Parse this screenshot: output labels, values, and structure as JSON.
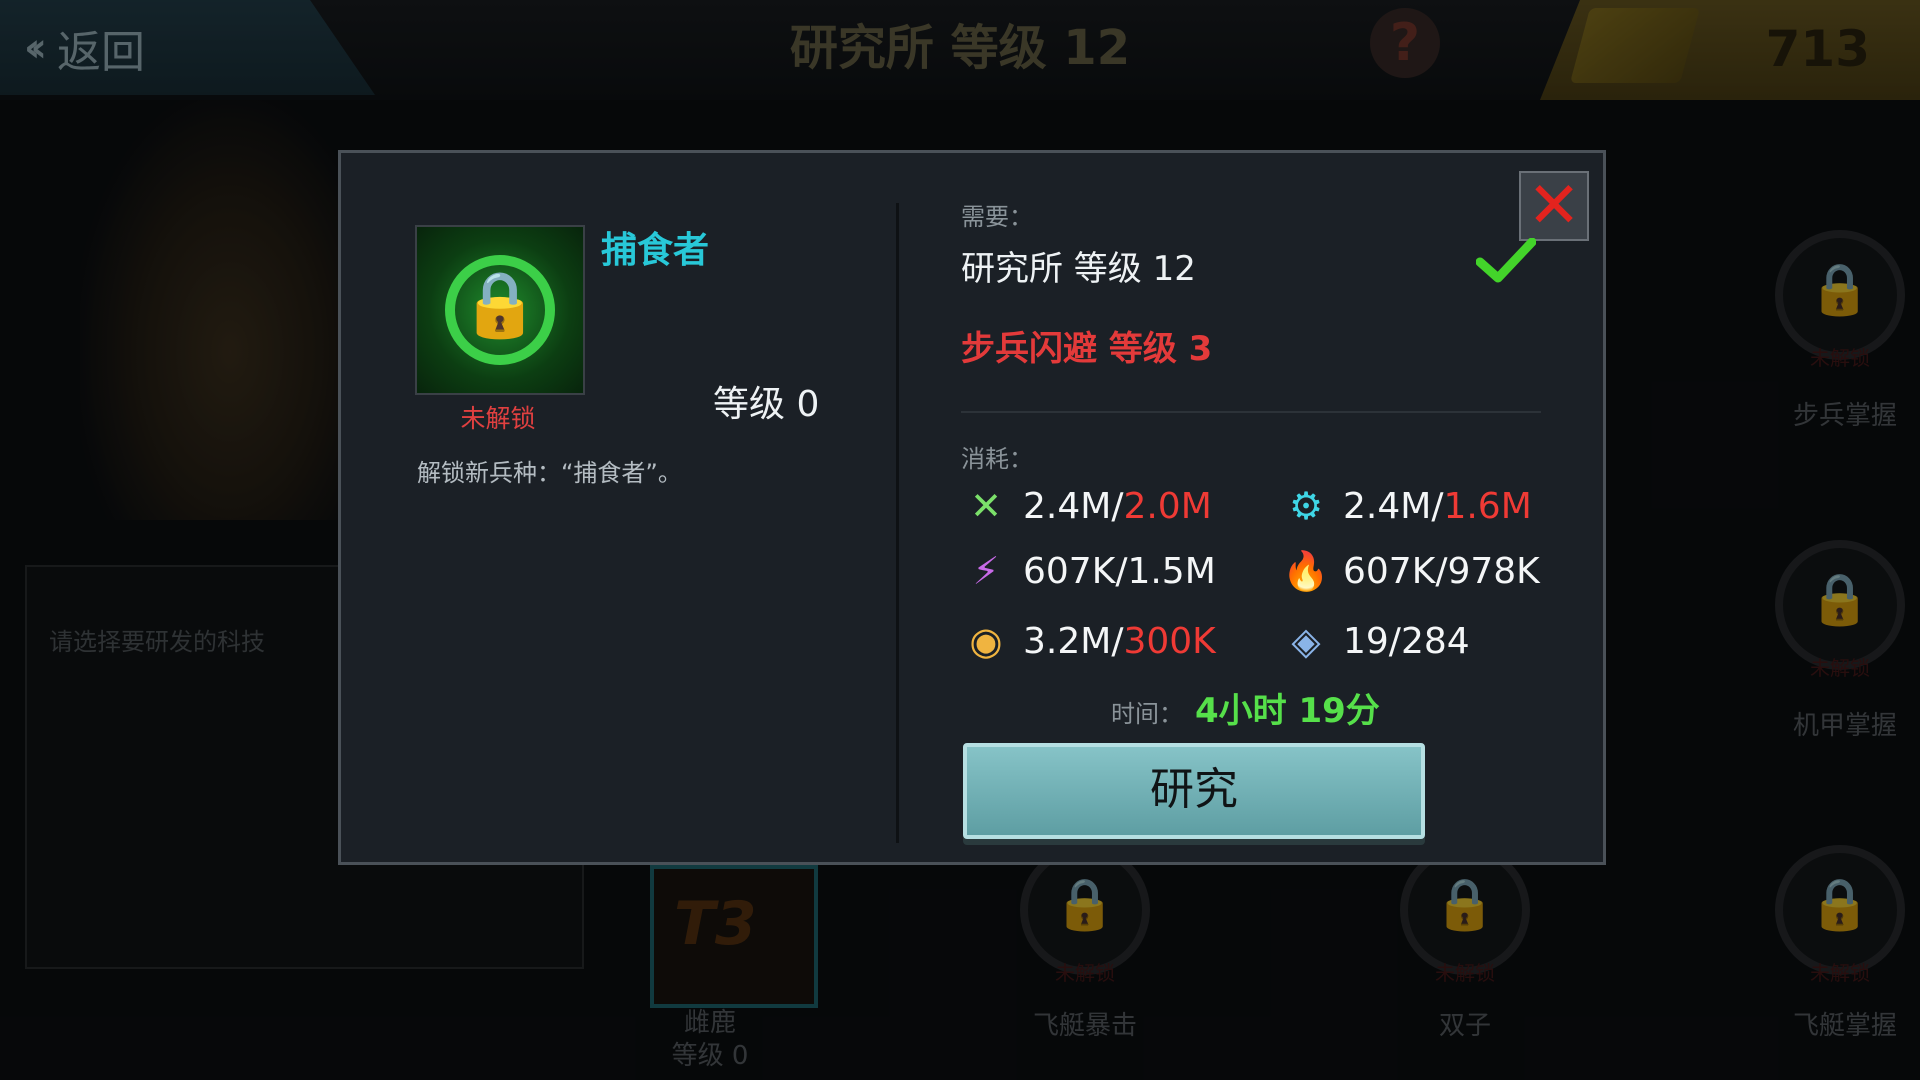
{
  "header": {
    "back_label": "返回",
    "title": "研究所 等级 12",
    "help_icon": "?",
    "currency_value": "713"
  },
  "background": {
    "left_hint": "请选择要研发的科技",
    "locked_text": "未解锁",
    "nodes": [
      {
        "name": "步兵掌握"
      },
      {
        "name": "机甲掌握"
      },
      {
        "name": "飞艇暴击"
      },
      {
        "name": "双子"
      },
      {
        "name": "飞艇掌握"
      }
    ],
    "t3_node": {
      "badge": "T3",
      "name": "雌鹿",
      "level": "等级 0"
    }
  },
  "modal": {
    "tech_name": "捕食者",
    "unlock_status": "未解锁",
    "level_text": "等级 0",
    "description": "解锁新兵种：“捕食者”。",
    "requirements_label": "需要：",
    "requirements": [
      {
        "text": "研究所 等级 12",
        "met": true
      },
      {
        "text": "步兵闪避 等级 3",
        "met": false
      }
    ],
    "cost_label": "消耗：",
    "resources": [
      {
        "icon": "food-icon",
        "have": "2.4M/",
        "need": "2.0M",
        "need_color": "#ef3a35"
      },
      {
        "icon": "gear-icon",
        "have": "2.4M/",
        "need": "1.6M",
        "need_color": "#ef3a35"
      },
      {
        "icon": "lightning-icon",
        "have": "607K/",
        "need": "1.5M",
        "need_color": "#f4f6f7"
      },
      {
        "icon": "fire-icon",
        "have": "607K/",
        "need": "978K",
        "need_color": "#f4f6f7"
      },
      {
        "icon": "coin-icon",
        "have": "3.2M/",
        "need": "300K",
        "need_color": "#ef3a35"
      },
      {
        "icon": "crystal-icon",
        "have": "19/",
        "need": "284",
        "need_color": "#f4f6f7"
      }
    ],
    "time_label": "时间：",
    "time_value": "4小时 19分",
    "research_button": "研究"
  }
}
